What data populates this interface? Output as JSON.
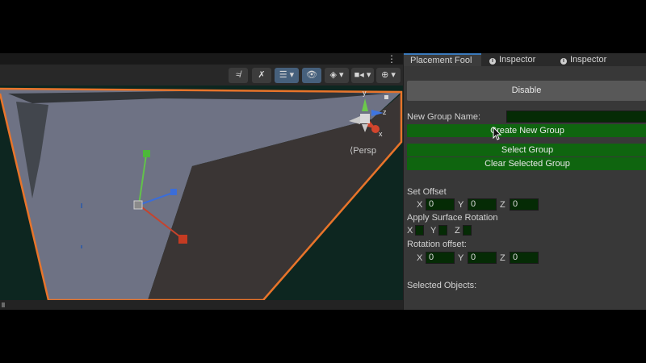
{
  "scene": {
    "menu_dots": "⋮",
    "toolbar": [
      {
        "icon": "visibility-off-icon",
        "glyph": "≉"
      },
      {
        "icon": "fx-off-icon",
        "glyph": "✗"
      },
      {
        "icon": "layers-dropdown-icon",
        "glyph": "☰ ▾"
      },
      {
        "icon": "eye-icon",
        "glyph": "👁"
      },
      {
        "icon": "stack-dropdown-icon",
        "glyph": "◈ ▾"
      },
      {
        "icon": "camera-dropdown-icon",
        "glyph": "■◂ ▾"
      },
      {
        "icon": "globe-dropdown-icon",
        "glyph": "⊕ ▾"
      }
    ],
    "gizmo_labels": {
      "y": "y",
      "z": "z",
      "x": "x"
    },
    "persp_label": "⟨Persp",
    "colors": {
      "selection_outline": "#e8742a",
      "plane_light": "#6e7284",
      "plane_dark": "#3a3534",
      "background": "#0d2620"
    }
  },
  "panel": {
    "tabs": [
      {
        "label": "Placement Fool",
        "active": true
      },
      {
        "label": "Inspector",
        "active": false,
        "icon": "info-icon"
      },
      {
        "label": "Inspector",
        "active": false,
        "icon": "info-icon"
      }
    ],
    "disable_button": "Disable",
    "new_group_name_label": "New Group Name:",
    "new_group_name_value": "",
    "create_group_button": "Create New Group",
    "select_group_button": "Select Group",
    "clear_group_button": "Clear Selected Group",
    "set_offset": {
      "label": "Set Offset",
      "x": "0",
      "y": "0",
      "z": "0"
    },
    "apply_surface_rotation": {
      "label": "Apply Surface Rotation",
      "x": false,
      "y": false,
      "z": false
    },
    "rotation_offset": {
      "label": "Rotation offset:",
      "x": "0",
      "y": "0",
      "z": "0"
    },
    "axis_labels": {
      "x": "X",
      "y": "Y",
      "z": "Z"
    },
    "selected_objects_label": "Selected Objects:",
    "colors": {
      "button_green": "#0f650f",
      "field_green": "#052b05",
      "panel_bg": "#383838"
    }
  }
}
